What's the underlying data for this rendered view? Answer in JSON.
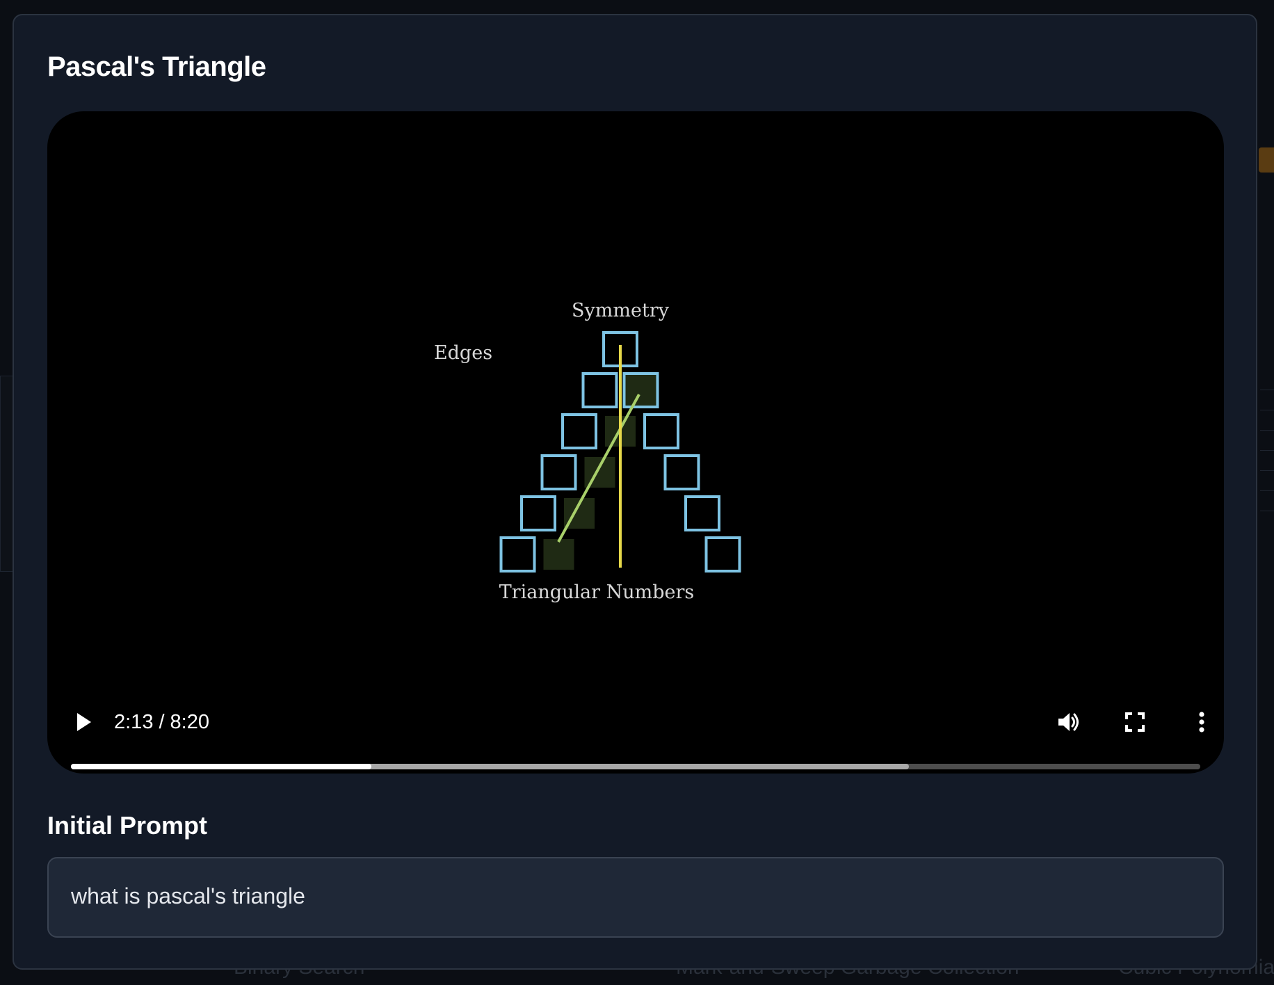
{
  "modal": {
    "title": "Pascal's Triangle"
  },
  "video": {
    "scene_labels": {
      "symmetry": "Symmetry",
      "edges": "Edges",
      "triangular_numbers": "Triangular Numbers"
    },
    "current_time": "2:13",
    "time_separator": "/",
    "duration": "8:20",
    "played_fraction": 0.266,
    "buffered_fraction": 0.742,
    "controls": {
      "play_icon": "play-icon",
      "volume_icon": "volume-icon",
      "fullscreen_icon": "fullscreen-icon",
      "more_icon": "more-vertical-icon"
    },
    "colors": {
      "cell_outline": "#7ec3e3",
      "symmetry_line": "#e6d84a",
      "diagonal_line": "#a8cf6a",
      "highlight_fill": "#1f2a14"
    }
  },
  "prompt": {
    "label": "Initial Prompt",
    "text": "what is pascal's triangle"
  },
  "background": {
    "footer_items": [
      "Binary Search",
      "Mark-and-Sweep Garbage Collection",
      "Cubic Polynomia"
    ]
  }
}
